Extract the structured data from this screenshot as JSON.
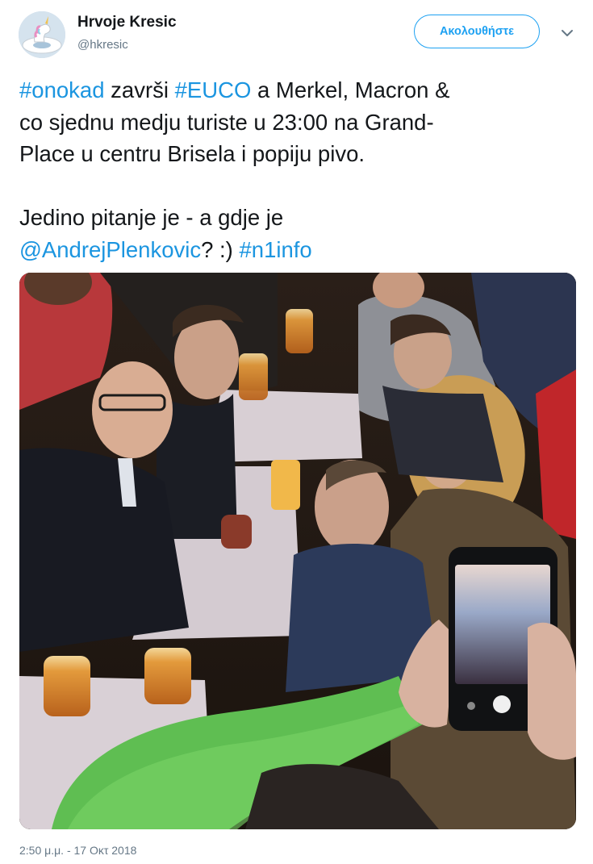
{
  "user": {
    "name": "Hrvoje Kresic",
    "handle": "@hkresic",
    "avatar_icon": "unicorn-float-avatar"
  },
  "header": {
    "follow_label": "Ακολουθήστε",
    "menu_icon": "chevron-down-icon"
  },
  "tweet": {
    "line1": {
      "hashtag1": "#onokad",
      "text1": " završi ",
      "hashtag2": "#EUCO",
      "text2": " a Merkel, Macron &"
    },
    "line2": "co sjednu medju turiste u 23:00 na Grand-",
    "line3": "Place u centru Brisela i popiju pivo.",
    "line4": "Jedino pitanje je - a gdje je",
    "line5": {
      "mention": "@AndrejPlenkovic",
      "text": "? :) ",
      "hashtag": "#n1info"
    }
  },
  "media": {
    "type": "photo",
    "icon": "photo-image"
  },
  "timestamp": "2:50 μ.μ. - 17 Οκτ 2018",
  "colors": {
    "link": "#1b95e0",
    "follow": "#1da1f2",
    "meta": "#657786",
    "text": "#14171a"
  }
}
